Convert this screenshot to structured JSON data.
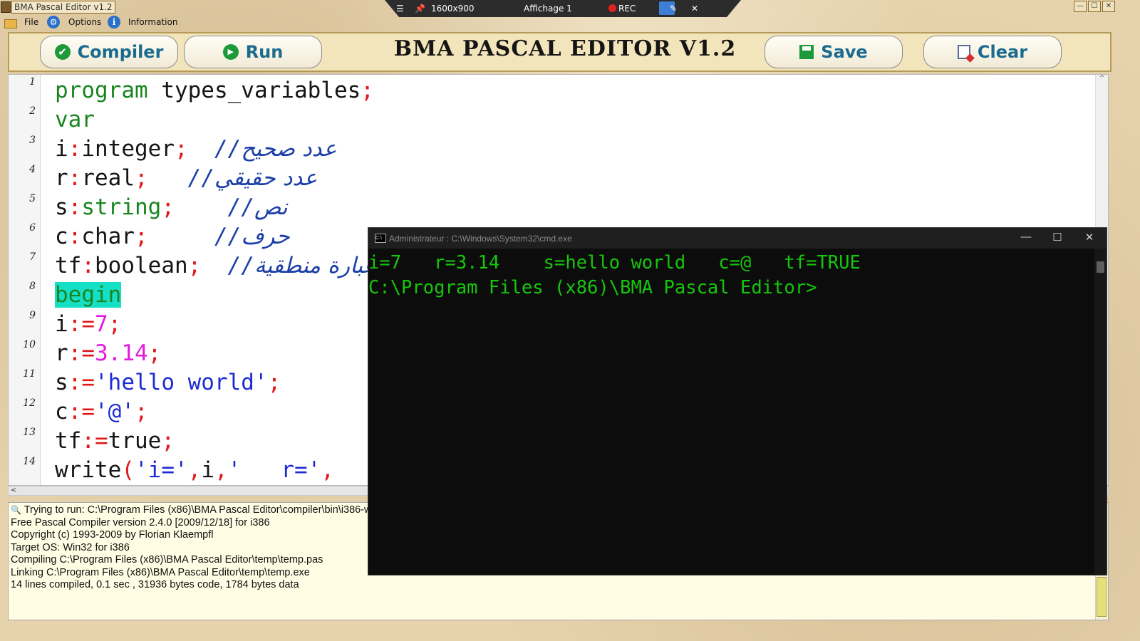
{
  "titlebar": {
    "app_title": "BMA Pascal Editor v1.2"
  },
  "recorder": {
    "resolution": "1600x900",
    "view": "Affichage 1",
    "rec_label": "REC"
  },
  "menu": {
    "file": "File",
    "options": "Options",
    "information": "Information"
  },
  "ribbon": {
    "compile_label": "Compiler",
    "run_label": "Run",
    "title": "BMA PASCAL EDITOR V1.2",
    "save_label": "Save",
    "clear_label": "Clear"
  },
  "editor": {
    "line_numbers": [
      "1",
      "2",
      "3",
      "4",
      "5",
      "6",
      "7",
      "8",
      "9",
      "10",
      "11",
      "12",
      "13",
      "14"
    ],
    "tokens": {
      "l1_kw": "program",
      "l1_rest": " types_variables",
      "semi": ";",
      "l2_kw": "var",
      "l3_a": "i",
      "colon": ":",
      "l3_b": "integer",
      "l3_cm": "  //",
      "l3_ar": "عدد صحيح",
      "l4_a": "r",
      "l4_b": "real",
      "l4_cm": "   //",
      "l4_ar": "عدد حقيقي",
      "l5_a": "s",
      "l5_b": "string",
      "l5_cm": "    //",
      "l5_ar": "نص",
      "l6_a": "c",
      "l6_b": "char",
      "l6_cm": "     //",
      "l6_ar": "حرف",
      "l7_a": "tf",
      "l7_b": "boolean",
      "l7_cm": "  //",
      "l7_ar": "عبارة منطقية",
      "l8_kw": "begin",
      "assign": ":=",
      "l9_val": "7",
      "l10_val": "3.14",
      "l11_str": "'hello world'",
      "l12_str": "'@'",
      "l13_val": "true",
      "l14_a": "write",
      "l14_paren": "(",
      "l14_s1": "'i='",
      "comma": ",",
      "l14_i": "i",
      "l14_s2": "'   r='"
    }
  },
  "output": {
    "lines": [
      "Trying to run: C:\\Program Files (x86)\\BMA Pascal Editor\\compiler\\bin\\i386-w",
      "Free Pascal Compiler version 2.4.0 [2009/12/18] for i386",
      "Copyright (c) 1993-2009 by Florian Klaempfl",
      "Target OS: Win32 for i386",
      "Compiling C:\\Program Files (x86)\\BMA Pascal Editor\\temp\\temp.pas",
      "Linking C:\\Program Files (x86)\\BMA Pascal Editor\\temp\\temp.exe",
      "14 lines compiled, 0.1 sec , 31936 bytes code, 1784 bytes data"
    ]
  },
  "cmd": {
    "title": "Administrateur : C:\\Windows\\System32\\cmd.exe",
    "icon_text": "C:\\",
    "output_line": "i=7   r=3.14    s=hello world   c=@   tf=TRUE",
    "prompt_line": "C:\\Program Files (x86)\\BMA Pascal Editor>"
  },
  "icons": {
    "minimize": "—",
    "maximize": "☐",
    "close": "✕",
    "hamburger": "☰",
    "pin": "📌",
    "pen": "✎",
    "scroll_left": "<",
    "scroll_up": "^",
    "scroll_down": "v",
    "search": "🔍",
    "check": "✔",
    "play": "▶",
    "info": "i",
    "gear": "⚙"
  },
  "colors": {
    "keyword": "#18861f",
    "string": "#1c2cd2",
    "number": "#e21be0",
    "cmd_text": "#16c60c"
  }
}
